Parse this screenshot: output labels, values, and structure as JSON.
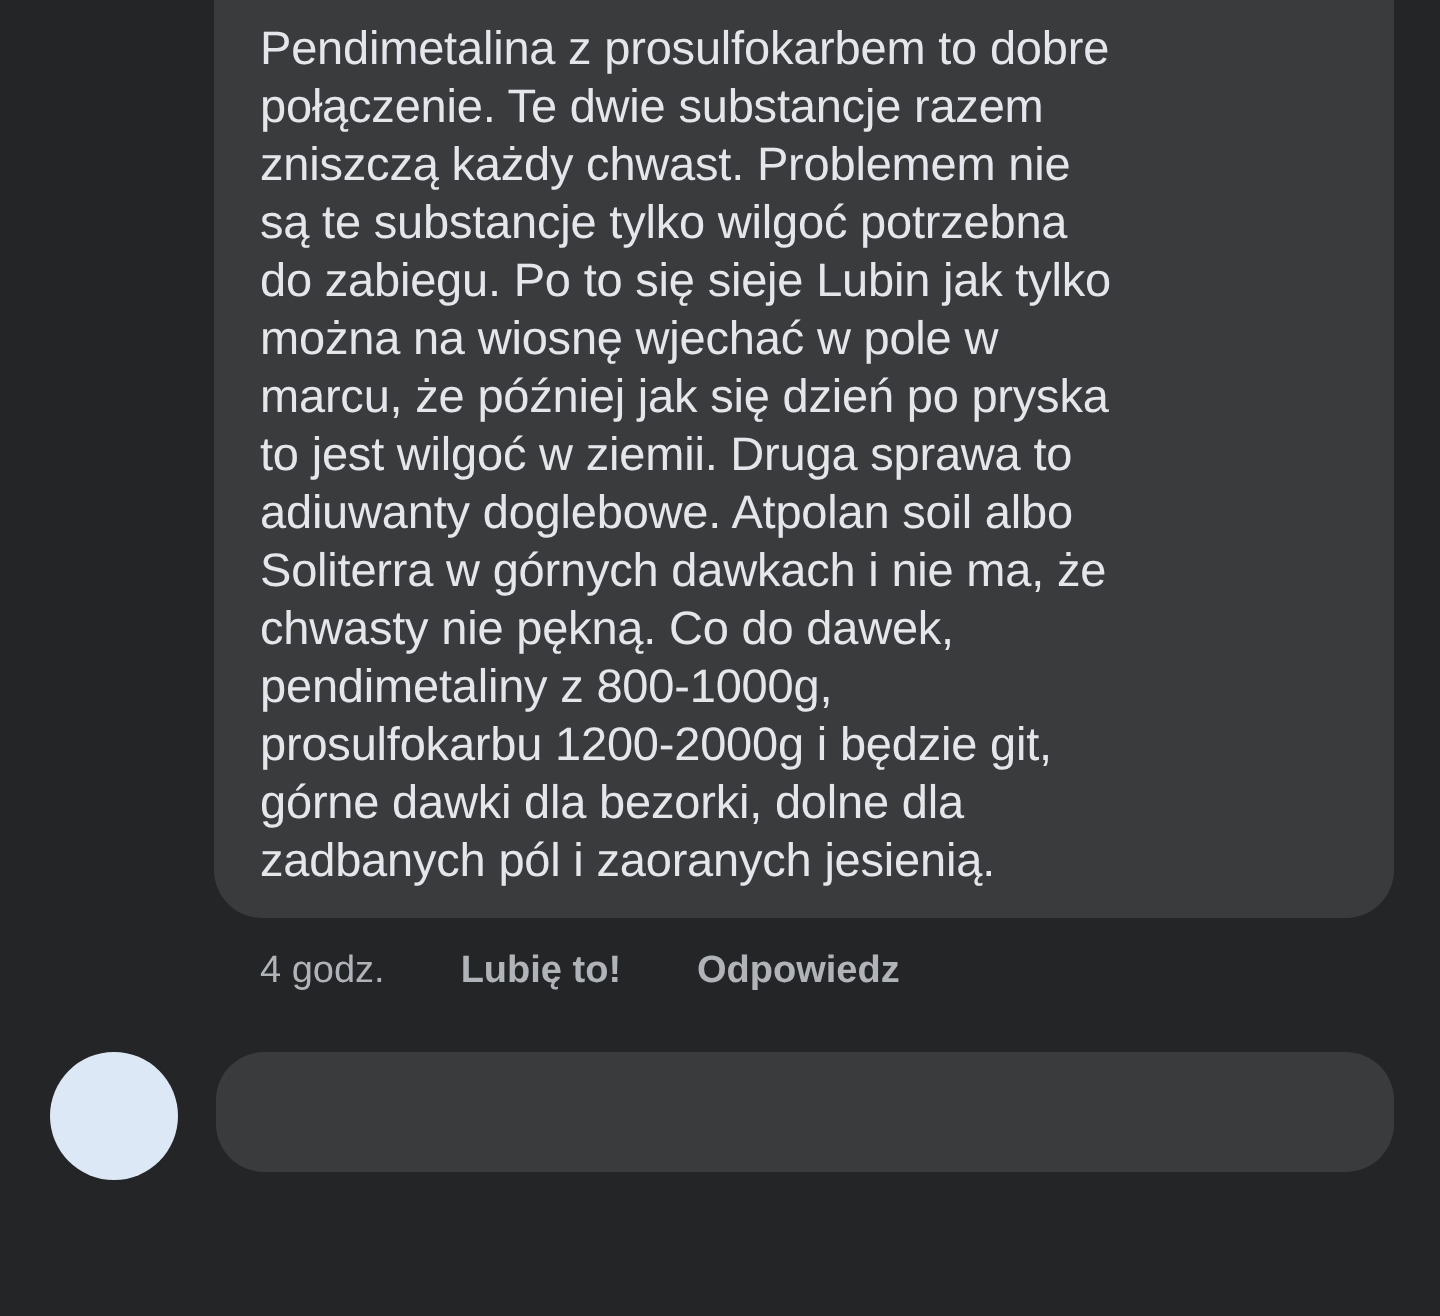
{
  "comment": {
    "text": "Pendimetalina z prosulfokarbem to dobre\npołączenie. Te dwie substancje razem\nzniszczą każdy chwast. Problemem nie\nsą te substancje tylko wilgoć potrzebna\ndo zabiegu. Po to się sieje Lubin jak tylko\nmożna na wiosnę wjechać w pole w\nmarcu, że później jak się dzień po pryska\nto jest wilgoć w ziemii. Druga sprawa to\nadiuwanty doglebowe. Atpolan soil albo\nSoliterra w górnych dawkach i nie ma, że\nchwasty nie pękną. Co do dawek,\npendimetaliny z 800-1000g,\nprosulfokarbu 1200-2000g i będzie git,\ngórne dawki dla bezorki, dolne dla\nzadbanych pól i zaoranych jesienią.",
    "time": "4 godz.",
    "actions": [
      "Lubię to!",
      "Odpowiedz"
    ]
  }
}
